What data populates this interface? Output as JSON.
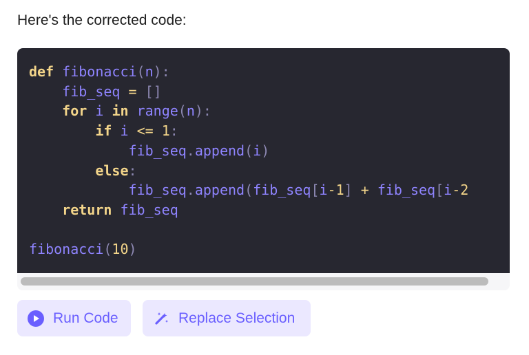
{
  "message": {
    "intro": "Here's the corrected code:"
  },
  "code": {
    "language": "python",
    "lines": [
      "def fibonacci(n):",
      "    fib_seq = []",
      "    for i in range(n):",
      "        if i <= 1:",
      "            fib_seq.append(i)",
      "        else:",
      "            fib_seq.append(fib_seq[i-1] + fib_seq[i-2",
      "    return fib_seq",
      "",
      "fibonacci(10)"
    ]
  },
  "actions": {
    "run_label": "Run Code",
    "replace_label": "Replace Selection"
  },
  "icons": {
    "run": "play-icon",
    "replace": "magic-wand-icon"
  },
  "colors": {
    "accent": "#6a5fff",
    "button_bg": "#ebe8ff",
    "code_bg": "#272730",
    "keyword": "#f3d58a",
    "identifier": "#8f84ff",
    "number": "#f3d58a",
    "punctuation": "#8d88b2"
  }
}
